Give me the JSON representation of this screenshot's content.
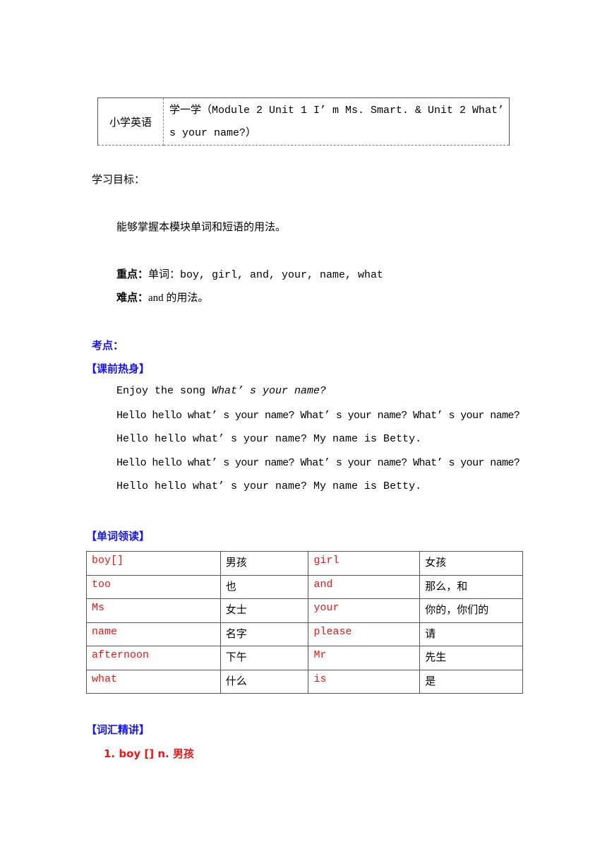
{
  "header": {
    "subject": "小学英语",
    "title_line1": "学一学（Module 2 Unit 1 I’ m Ms. Smart. & Unit 2 What’",
    "title_line2": "s your name?）"
  },
  "objectives": {
    "heading": "学习目标：",
    "goal": "能够掌握本模块单词和短语的用法。",
    "key_label": "重点：",
    "key_text": "单词：boy, girl, and, your, name, what",
    "difficult_label": "难点：",
    "difficult_text": "and 的用法。"
  },
  "exam_points": {
    "heading": "考点：",
    "warmup_heading": "【课前热身】",
    "song_intro": "Enjoy the song ",
    "song_title": "What’ s your name?",
    "lyrics": [
      "Hello hello what’ s your name? What’ s your name? What’ s your name?",
      "Hello hello what’ s your name? My name is Betty.",
      "Hello hello what’ s your name? What’ s your name? What’ s your name?",
      "Hello hello what’ s your name? My name is Betty."
    ]
  },
  "vocab_section": {
    "heading": "【单词领读】",
    "rows": [
      {
        "word1": "boy[]",
        "meaning1": "男孩",
        "word2": "girl",
        "meaning2": "女孩"
      },
      {
        "word1": "too",
        "meaning1": "也",
        "word2": "and",
        "meaning2": "那么，和"
      },
      {
        "word1": "Ms",
        "meaning1": "女士",
        "word2": "your",
        "meaning2": "你的，你们的"
      },
      {
        "word1": "name",
        "meaning1": "名字",
        "word2": "please",
        "meaning2": "请"
      },
      {
        "word1": "afternoon",
        "meaning1": "下午",
        "word2": "Mr",
        "meaning2": "先生"
      },
      {
        "word1": "what",
        "meaning1": "什么",
        "word2": "is",
        "meaning2": "是"
      }
    ]
  },
  "explanation": {
    "heading": "【词汇精讲】",
    "item1": "1. boy [] n. 男孩"
  },
  "colors": {
    "heading_blue": "#1515f0",
    "vocab_red": "#f01414"
  }
}
